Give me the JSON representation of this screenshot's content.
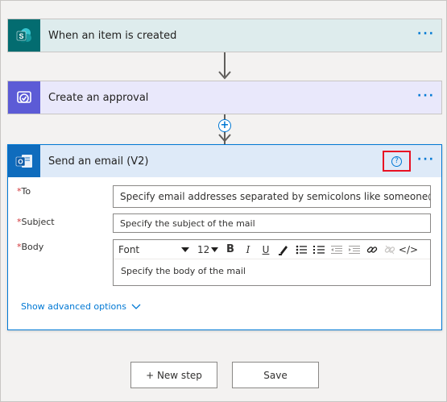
{
  "steps": {
    "trigger": {
      "title": "When an item is created",
      "more": "···"
    },
    "approval": {
      "title": "Create an approval",
      "more": "···"
    },
    "email": {
      "title": "Send an email (V2)",
      "more": "···",
      "help": "?"
    }
  },
  "add_step": "+",
  "fields": {
    "to": {
      "label": "To",
      "placeholder": "Specify email addresses separated by semicolons like someone@"
    },
    "subject": {
      "label": "Subject",
      "placeholder": "Specify the subject of the mail"
    },
    "body": {
      "label": "Body",
      "placeholder": "Specify the body of the mail"
    }
  },
  "required_mark": "*",
  "toolbar": {
    "font": "Font",
    "size": "12",
    "bold": "B",
    "italic": "I",
    "underline": "U",
    "code": "</>"
  },
  "advanced_options": "Show advanced options",
  "buttons": {
    "new_step": "+ New step",
    "save": "Save"
  },
  "colors": {
    "sharepoint": "#036c70",
    "approval": "#5c5bd6",
    "outlook": "#0f6cbd",
    "accent": "#0078d4",
    "highlight": "#e81123"
  }
}
